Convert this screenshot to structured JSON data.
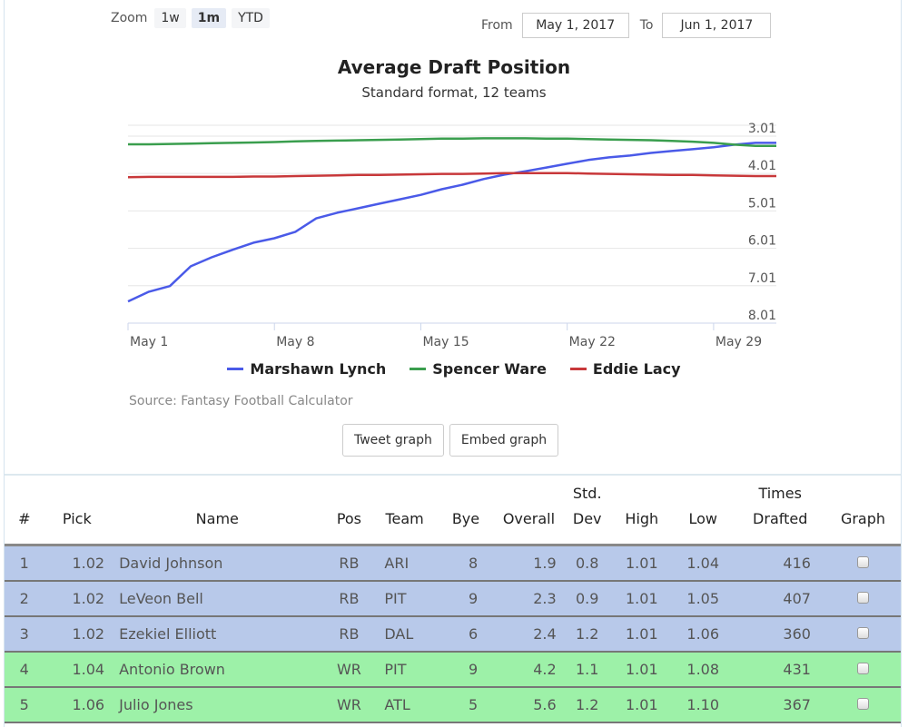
{
  "zoom": {
    "label": "Zoom",
    "options": [
      "1w",
      "1m",
      "YTD"
    ],
    "active": "1m"
  },
  "range": {
    "from_label": "From",
    "from_value": "May 1, 2017",
    "to_label": "To",
    "to_value": "Jun 1, 2017"
  },
  "chart_data": {
    "type": "line",
    "title": "Average Draft Position",
    "subtitle": "Standard format, 12 teams",
    "xlabel": "",
    "ylabel": "",
    "x_ticks": [
      "May 1",
      "May 8",
      "May 15",
      "May 22",
      "May 29"
    ],
    "y_ticks": [
      "3.01",
      "4.01",
      "5.01",
      "6.01",
      "7.01",
      "8.01"
    ],
    "y_axis": "inverted, right side",
    "ylim": [
      2.7,
      8.01
    ],
    "grid": true,
    "legend": "bottom-center",
    "x": [
      "May 1",
      "May 2",
      "May 3",
      "May 4",
      "May 5",
      "May 6",
      "May 7",
      "May 8",
      "May 9",
      "May 10",
      "May 11",
      "May 12",
      "May 13",
      "May 14",
      "May 15",
      "May 16",
      "May 17",
      "May 18",
      "May 19",
      "May 20",
      "May 21",
      "May 22",
      "May 23",
      "May 24",
      "May 25",
      "May 26",
      "May 27",
      "May 28",
      "May 29",
      "May 30",
      "May 31"
    ],
    "series": [
      {
        "name": "Marshawn Lynch",
        "color": "#4a5ae8",
        "values": [
          7.43,
          7.17,
          7.02,
          6.49,
          6.25,
          6.05,
          5.86,
          5.74,
          5.57,
          5.21,
          5.06,
          4.94,
          4.82,
          4.7,
          4.58,
          4.43,
          4.31,
          4.16,
          4.04,
          3.95,
          3.85,
          3.75,
          3.65,
          3.58,
          3.53,
          3.46,
          3.41,
          3.36,
          3.31,
          3.24,
          3.19
        ]
      },
      {
        "name": "Spencer Ware",
        "color": "#3a9e4e",
        "values": [
          3.23,
          3.23,
          3.22,
          3.21,
          3.2,
          3.19,
          3.18,
          3.17,
          3.15,
          3.14,
          3.13,
          3.12,
          3.11,
          3.1,
          3.09,
          3.08,
          3.08,
          3.07,
          3.07,
          3.07,
          3.08,
          3.08,
          3.09,
          3.1,
          3.11,
          3.12,
          3.14,
          3.16,
          3.19,
          3.24,
          3.27
        ]
      },
      {
        "name": "Eddie Lacy",
        "color": "#c8383a",
        "values": [
          4.11,
          4.1,
          4.1,
          4.1,
          4.1,
          4.1,
          4.09,
          4.09,
          4.08,
          4.07,
          4.06,
          4.05,
          4.05,
          4.04,
          4.03,
          4.02,
          4.02,
          4.01,
          4.0,
          4.0,
          4.0,
          4.0,
          4.01,
          4.02,
          4.03,
          4.04,
          4.05,
          4.05,
          4.06,
          4.07,
          4.08
        ]
      }
    ]
  },
  "source": "Source: Fantasy Football Calculator",
  "buttons": {
    "tweet": "Tweet graph",
    "embed": "Embed graph"
  },
  "table": {
    "headers": {
      "num": "#",
      "pick": "Pick",
      "name": "Name",
      "pos": "Pos",
      "team": "Team",
      "bye": "Bye",
      "overall": "Overall",
      "std_top": "Std.",
      "std": "Dev",
      "high": "High",
      "low": "Low",
      "times_top": "Times",
      "times": "Drafted",
      "graph": "Graph"
    },
    "rows": [
      {
        "num": "1",
        "pick": "1.02",
        "name": "David Johnson",
        "pos": "RB",
        "team": "ARI",
        "bye": "8",
        "overall": "1.9",
        "std": "0.8",
        "high": "1.01",
        "low": "1.04",
        "times": "416"
      },
      {
        "num": "2",
        "pick": "1.02",
        "name": "LeVeon Bell",
        "pos": "RB",
        "team": "PIT",
        "bye": "9",
        "overall": "2.3",
        "std": "0.9",
        "high": "1.01",
        "low": "1.05",
        "times": "407"
      },
      {
        "num": "3",
        "pick": "1.02",
        "name": "Ezekiel Elliott",
        "pos": "RB",
        "team": "DAL",
        "bye": "6",
        "overall": "2.4",
        "std": "1.2",
        "high": "1.01",
        "low": "1.06",
        "times": "360"
      },
      {
        "num": "4",
        "pick": "1.04",
        "name": "Antonio Brown",
        "pos": "WR",
        "team": "PIT",
        "bye": "9",
        "overall": "4.2",
        "std": "1.1",
        "high": "1.01",
        "low": "1.08",
        "times": "431"
      },
      {
        "num": "5",
        "pick": "1.06",
        "name": "Julio Jones",
        "pos": "WR",
        "team": "ATL",
        "bye": "5",
        "overall": "5.6",
        "std": "1.2",
        "high": "1.01",
        "low": "1.10",
        "times": "367"
      }
    ],
    "position_colors": {
      "RB": "#b8c9ea",
      "WR": "#9df1a8"
    }
  }
}
